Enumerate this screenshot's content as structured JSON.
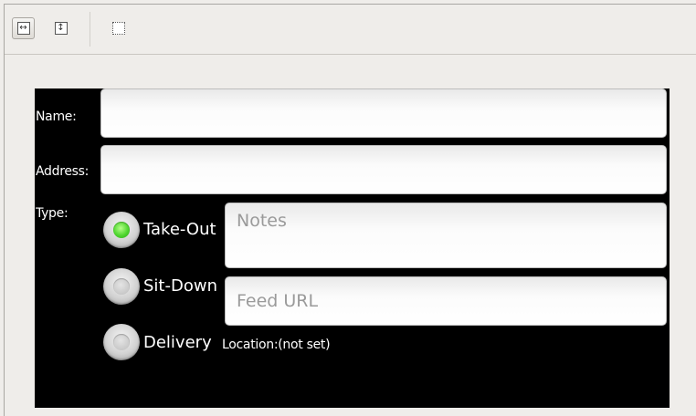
{
  "toolbar": {
    "buttons": [
      {
        "icon": "fit-width-icon",
        "glyph": "↔",
        "active": true
      },
      {
        "icon": "fit-height-icon",
        "glyph": "↕",
        "active": false
      },
      {
        "icon": "toggle-margins-icon",
        "glyph": "",
        "active": false
      }
    ]
  },
  "form": {
    "name_label": "Name:",
    "address_label": "Address:",
    "type_label": "Type:",
    "name_value": "",
    "address_value": "",
    "types": [
      {
        "label": "Take-Out",
        "checked": true
      },
      {
        "label": "Sit-Down",
        "checked": false
      },
      {
        "label": "Delivery",
        "checked": false
      }
    ],
    "notes_placeholder": "Notes",
    "feed_url_placeholder": "Feed URL",
    "location_label": "Location:",
    "location_value": "(not set)"
  },
  "colors": {
    "canvas_bg": "#000000",
    "radio_checked": "#4fd62f",
    "chrome_bg": "#efedea"
  }
}
